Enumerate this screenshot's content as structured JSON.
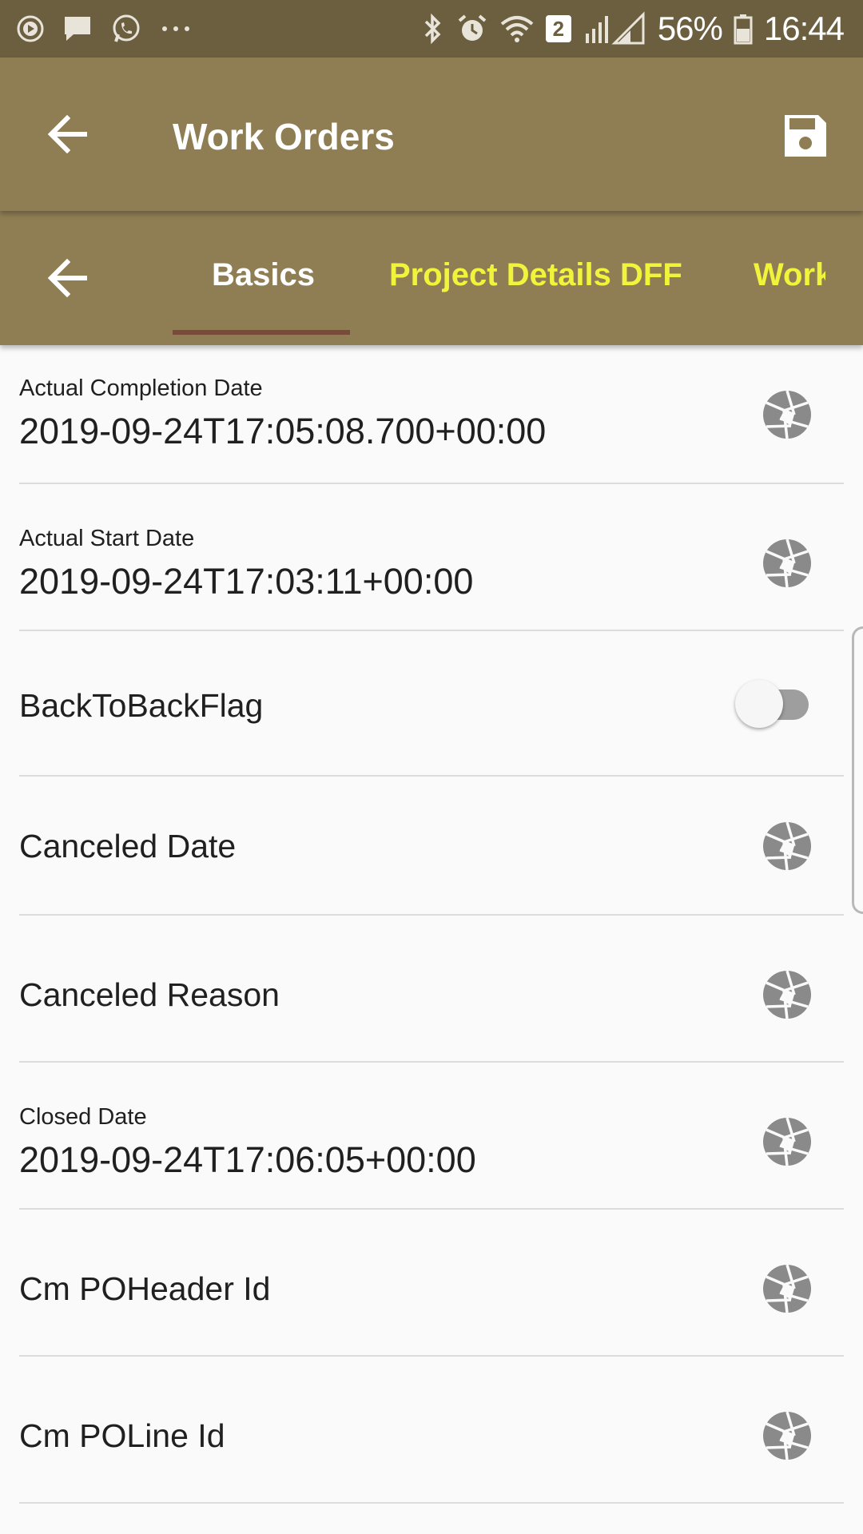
{
  "status_bar": {
    "battery": "56%",
    "time": "16:44",
    "sim_badge": "2",
    "icons": [
      "play-circle-icon",
      "message-icon",
      "whatsapp-icon",
      "more-dots-icon",
      "bluetooth-icon",
      "alarm-icon",
      "wifi-icon",
      "signal-icon",
      "battery-icon"
    ]
  },
  "app_bar": {
    "title": "Work Orders",
    "back_icon": "arrow-back-icon",
    "save_icon": "save-icon"
  },
  "tabs": [
    {
      "label": "Basics",
      "selected": true
    },
    {
      "label": "Project Details DFF",
      "selected": false
    },
    {
      "label": "Work",
      "selected": false
    }
  ],
  "colors": {
    "status_bar": "#6b5f40",
    "app_bar": "#8f7e54",
    "tab_selected": "#ffffff",
    "tab_unselected": "#f0f43a",
    "indicator": "#7a4a3a"
  },
  "fields": [
    {
      "label": "Actual Completion Date",
      "value": "2019-09-24T17:05:08.700+00:00",
      "icon": "aperture-icon"
    },
    {
      "label": "Actual Start Date",
      "value": "2019-09-24T17:03:11+00:00",
      "icon": "aperture-icon"
    },
    {
      "label": "BackToBackFlag",
      "toggle": false
    },
    {
      "label": "Canceled Date",
      "icon": "aperture-icon"
    },
    {
      "label": "Canceled Reason",
      "icon": "aperture-icon"
    },
    {
      "label": "Closed Date",
      "value": "2019-09-24T17:06:05+00:00",
      "icon": "aperture-icon"
    },
    {
      "label": "Cm POHeader Id",
      "icon": "aperture-icon"
    },
    {
      "label": "Cm POLine Id",
      "icon": "aperture-icon"
    }
  ]
}
